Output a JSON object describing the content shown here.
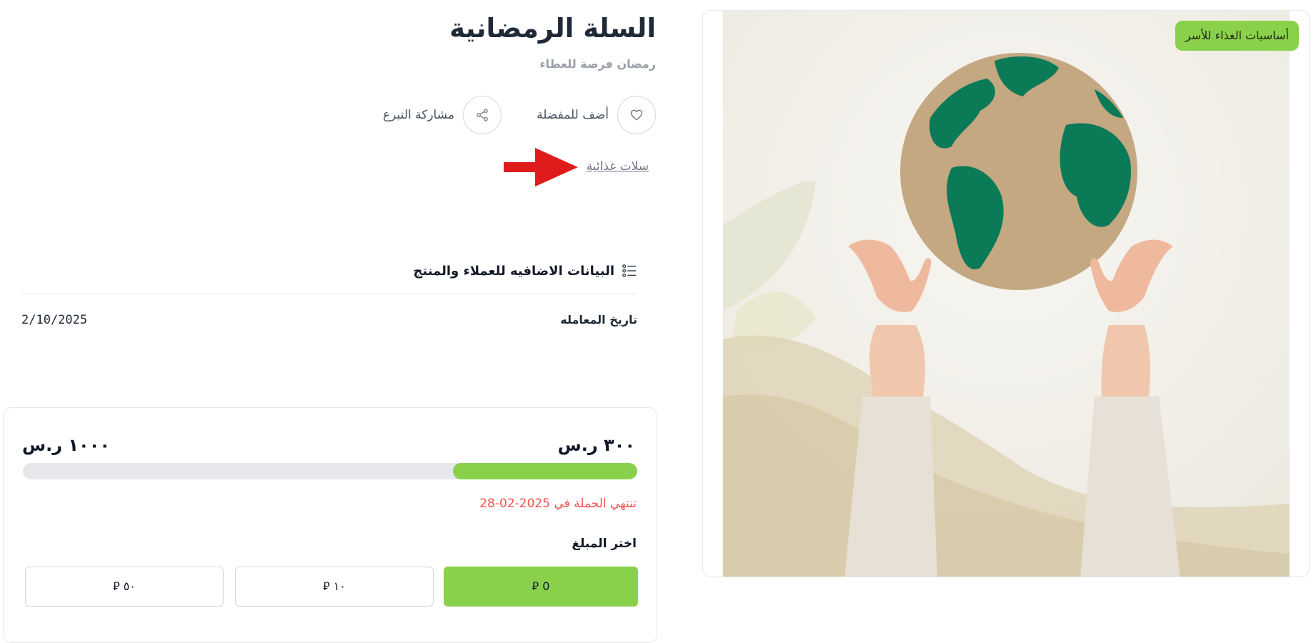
{
  "product": {
    "title": "السلة الرمضانية",
    "subtitle": "رمضان فرصة للعطاء",
    "category_badge": "أساسيات الغذاء للأسر",
    "category_link": "سلات غذائية"
  },
  "actions": {
    "favorite_label": "أضف للمفضلة",
    "share_label": "مشاركة التبرع"
  },
  "extra_info": {
    "heading": "البيانات الاضافيه للعملاء والمنتج",
    "rows": [
      {
        "label": "تاريخ المعامله",
        "value": "2/10/2025"
      }
    ]
  },
  "donation": {
    "raised_text": "٣٠٠ ر.س",
    "goal_text": "١٠٠٠ ر.س",
    "progress_fraction": 0.3,
    "ends_text": "تنتهي الحملة في 2025-02-28",
    "choose_label": "اختر المبلغ",
    "amounts": [
      "0 ⃁",
      "١٠ ⃁",
      "٥٠ ⃁"
    ],
    "selected_amount_index": 0
  },
  "colors": {
    "accent": "#8ad14b",
    "danger": "#ef5350",
    "arrow": "#e01b1b",
    "globe_land": "#0b7a57",
    "globe_ocean": "#c4a882"
  },
  "icons": {
    "favorite": "heart-icon",
    "share": "share-icon",
    "info": "list-icon",
    "annotation": "red-arrow"
  }
}
